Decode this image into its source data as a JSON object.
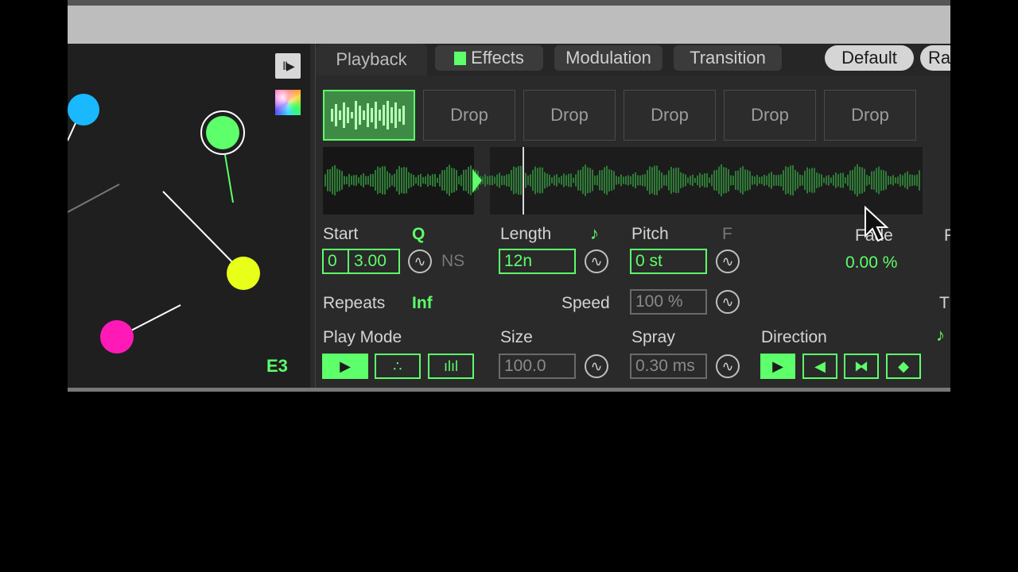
{
  "left_panel": {
    "note_label": "E3",
    "play_toggle_icon": "play-step-icon",
    "color_picker_icon": "color-wheel-icon",
    "nodes": [
      {
        "name": "blue-node",
        "color": "#1ab8ff"
      },
      {
        "name": "green-node",
        "color": "#5dff6a"
      },
      {
        "name": "yellow-node",
        "color": "#e8ff1a"
      },
      {
        "name": "magenta-node",
        "color": "#ff1ab8"
      }
    ]
  },
  "tabs": [
    {
      "label": "Playback"
    },
    {
      "label": "Effects"
    },
    {
      "label": "Modulation"
    },
    {
      "label": "Transition"
    }
  ],
  "presets": {
    "default_label": "Default",
    "random_label": "Ra"
  },
  "slots": [
    "Drop",
    "Drop",
    "Drop",
    "Drop",
    "Drop"
  ],
  "params": {
    "start": {
      "label": "Start",
      "quantize": "Q",
      "value_a": "0",
      "value_b": "3.00",
      "ns": "NS"
    },
    "length": {
      "label": "Length",
      "value": "12n",
      "sync_icon": "note-icon"
    },
    "pitch": {
      "label": "Pitch",
      "value": "0 st",
      "flag": "F"
    },
    "fade": {
      "label": "Fade",
      "value": "0.00 %",
      "edge_label": "F"
    },
    "repeats": {
      "label": "Repeats",
      "value": "Inf"
    },
    "speed": {
      "label": "Speed",
      "value": "100 %"
    },
    "edge_right_label": "T",
    "play_mode": {
      "label": "Play Mode"
    },
    "size": {
      "label": "Size",
      "value": "100.0"
    },
    "spray": {
      "label": "Spray",
      "value": "0.30 ms"
    },
    "direction": {
      "label": "Direction"
    }
  },
  "colors": {
    "accent": "#5dff6a",
    "panel": "#2a2a2a",
    "topbar": "#bdbdbd"
  }
}
